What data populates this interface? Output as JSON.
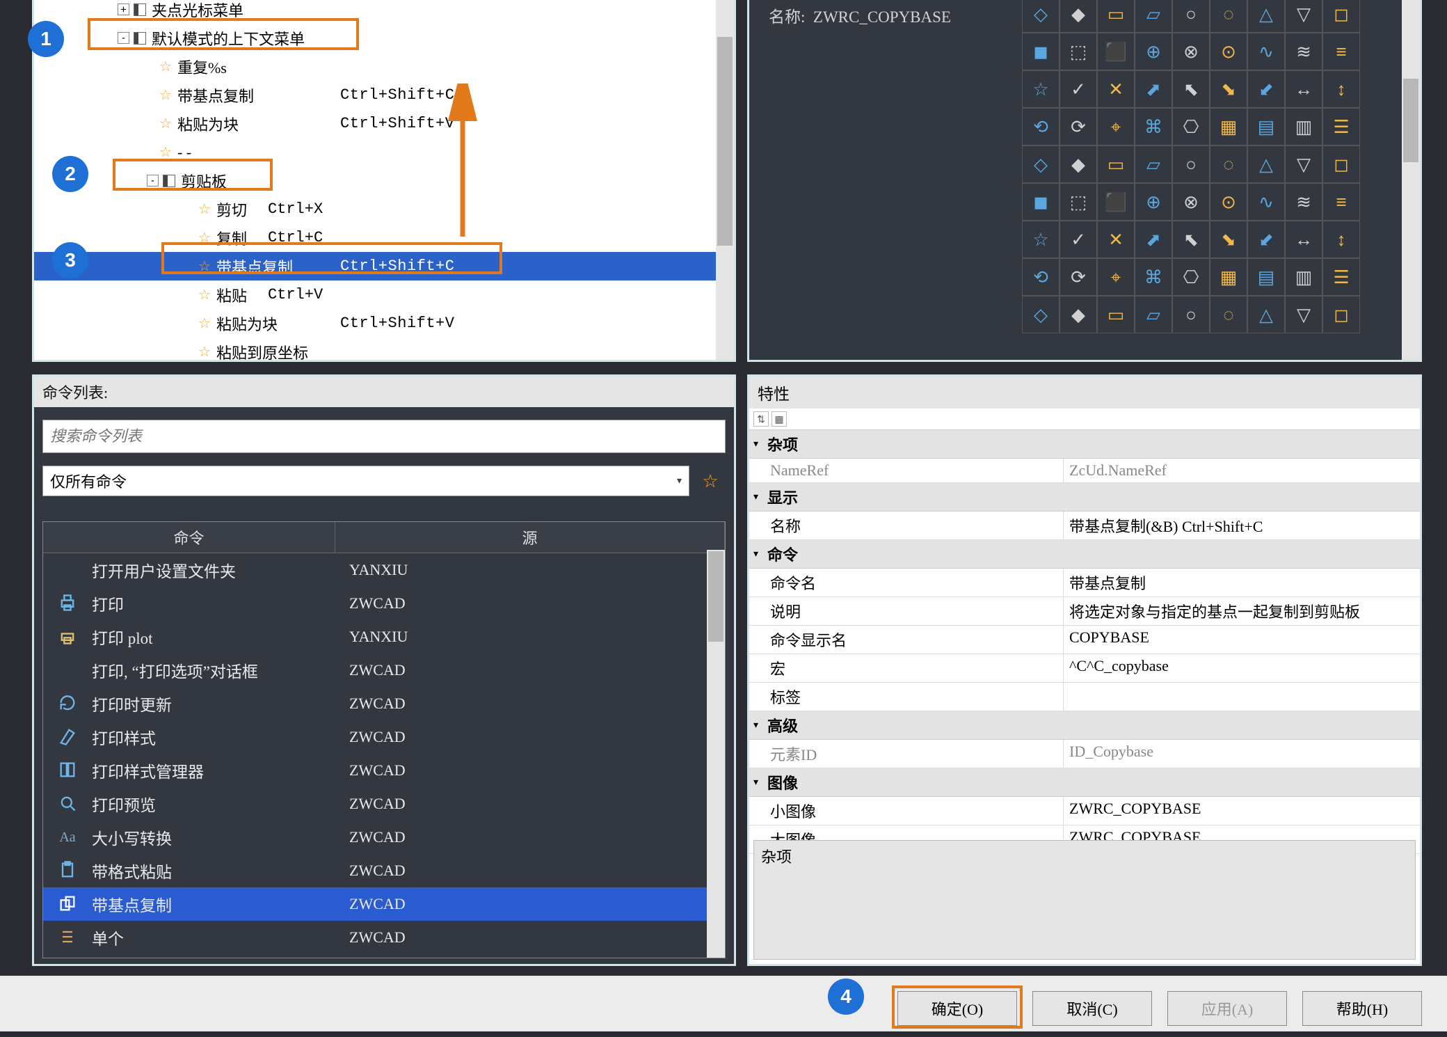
{
  "tree": {
    "items": [
      {
        "indent": 120,
        "expander": "+",
        "icon": "ni",
        "label": "夹点光标菜单",
        "shortcut": ""
      },
      {
        "indent": 120,
        "expander": "-",
        "icon": "ni",
        "label": "默认模式的上下文菜单",
        "shortcut": ""
      },
      {
        "indent": 180,
        "icon": "star",
        "label": "重复%s",
        "shortcut": ""
      },
      {
        "indent": 180,
        "icon": "star",
        "label": "带基点复制",
        "shortcut": "Ctrl+Shift+C"
      },
      {
        "indent": 180,
        "icon": "star",
        "label": "粘贴为块",
        "shortcut": "Ctrl+Shift+V"
      },
      {
        "indent": 180,
        "icon": "star",
        "label": "- -",
        "shortcut": ""
      },
      {
        "indent": 162,
        "expander": "-",
        "icon": "ni",
        "label": "剪贴板",
        "shortcut": ""
      },
      {
        "indent": 236,
        "icon": "star",
        "label": "剪切",
        "shortcut2": "Ctrl+X"
      },
      {
        "indent": 236,
        "icon": "star",
        "label": "复制",
        "shortcut2": "Ctrl+C"
      },
      {
        "indent": 236,
        "icon": "star",
        "label": "带基点复制",
        "shortcut": "Ctrl+Shift+C",
        "selected": true
      },
      {
        "indent": 236,
        "icon": "star",
        "label": "粘贴",
        "shortcut2": "Ctrl+V"
      },
      {
        "indent": 236,
        "icon": "star",
        "label": "粘贴为块",
        "shortcut": "Ctrl+Shift+V"
      },
      {
        "indent": 236,
        "icon": "star",
        "label": "粘贴到原坐标",
        "shortcut": ""
      }
    ]
  },
  "palette": {
    "name_label": "名称:",
    "name_value": "ZWRC_COPYBASE"
  },
  "cmd": {
    "header": "命令列表:",
    "search_placeholder": "搜索命令列表",
    "filter": "仅所有命令",
    "th_cmd": "命令",
    "th_src": "源",
    "rows": [
      {
        "icon": "",
        "text": "打开用户设置文件夹",
        "src": "YANXIU"
      },
      {
        "icon": "printer",
        "text": "打印",
        "src": "ZWCAD"
      },
      {
        "icon": "printer2",
        "text": "打印 plot",
        "src": "YANXIU"
      },
      {
        "icon": "",
        "text": "打印, “打印选项”对话框",
        "src": "ZWCAD"
      },
      {
        "icon": "refresh",
        "text": "打印时更新",
        "src": "ZWCAD"
      },
      {
        "icon": "style",
        "text": "打印样式",
        "src": "ZWCAD"
      },
      {
        "icon": "stylemgr",
        "text": "打印样式管理器",
        "src": "ZWCAD"
      },
      {
        "icon": "preview",
        "text": "打印预览",
        "src": "ZWCAD"
      },
      {
        "icon": "aa",
        "text": "大小写转换",
        "src": "ZWCAD"
      },
      {
        "icon": "paste",
        "text": "带格式粘贴",
        "src": "ZWCAD"
      },
      {
        "icon": "copybase",
        "text": "带基点复制",
        "src": "ZWCAD",
        "selected": true
      },
      {
        "icon": "list",
        "text": "单个",
        "src": "ZWCAD"
      }
    ]
  },
  "props": {
    "header": "特性",
    "cat_misc": "杂项",
    "row_nameref_k": "NameRef",
    "row_nameref_v": "ZcUd.NameRef",
    "cat_display": "显示",
    "row_name_k": "名称",
    "row_name_v": "带基点复制(&B)        Ctrl+Shift+C",
    "cat_cmd": "命令",
    "row_cmdname_k": "命令名",
    "row_cmdname_v": "带基点复制",
    "row_desc_k": "说明",
    "row_desc_v": "将选定对象与指定的基点一起复制到剪贴板",
    "row_dispname_k": "命令显示名",
    "row_dispname_v": "COPYBASE",
    "row_macro_k": "宏",
    "row_macro_v": "^C^C_copybase",
    "row_tag_k": "标签",
    "row_tag_v": "",
    "cat_adv": "高级",
    "row_elemid_k": "元素ID",
    "row_elemid_v": "ID_Copybase",
    "cat_img": "图像",
    "row_simg_k": "小图像",
    "row_simg_v": "ZWRC_COPYBASE",
    "row_limg_k": "大图像",
    "row_limg_v": "ZWRC_COPYBASE",
    "footer": "杂项"
  },
  "buttons": {
    "ok": "确定(O)",
    "cancel": "取消(C)",
    "apply": "应用(A)",
    "help": "帮助(H)"
  },
  "annotations": {
    "b1": "1",
    "b2": "2",
    "b3": "3",
    "b4": "4"
  }
}
